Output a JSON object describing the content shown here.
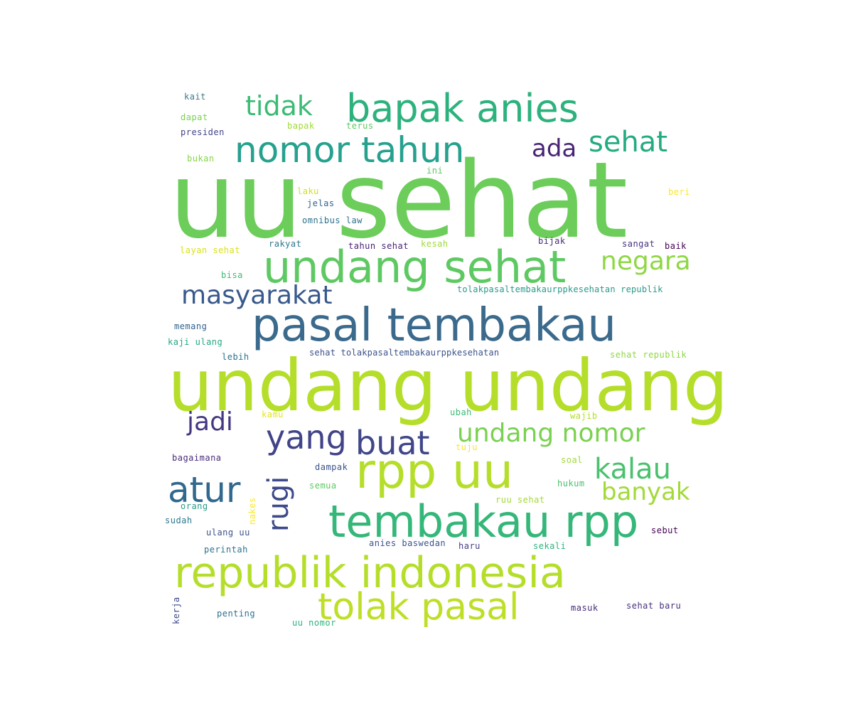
{
  "wordcloud": {
    "words": [
      {
        "text": "uu sehat",
        "color": "#6ccd5a"
      },
      {
        "text": "undang undang",
        "color": "#b5de2b"
      },
      {
        "text": "pasal tembakau",
        "color": "#3b6a8c"
      },
      {
        "text": "republik indonesia",
        "color": "#b5de2b"
      },
      {
        "text": "undang sehat",
        "color": "#5ec962"
      },
      {
        "text": "rpp uu",
        "color": "#b5de2b"
      },
      {
        "text": "tembakau rpp",
        "color": "#35b779"
      },
      {
        "text": "bapak anies",
        "color": "#2db27d"
      },
      {
        "text": "nomor tahun",
        "color": "#25a18e"
      },
      {
        "text": "tolak pasal",
        "color": "#bddf26"
      },
      {
        "text": "atur",
        "color": "#31688e"
      },
      {
        "text": "undang nomor",
        "color": "#7ad151"
      },
      {
        "text": "kalau",
        "color": "#4ac16d"
      },
      {
        "text": "buat",
        "color": "#404688"
      },
      {
        "text": "yang",
        "color": "#414487"
      },
      {
        "text": "masyarakat",
        "color": "#38598c"
      },
      {
        "text": "negara",
        "color": "#8fd744"
      },
      {
        "text": "banyak",
        "color": "#a2da37"
      },
      {
        "text": "tidak",
        "color": "#3cbb75"
      },
      {
        "text": "sehat",
        "color": "#25ab82"
      },
      {
        "text": "jadi",
        "color": "#453882"
      },
      {
        "text": "ada",
        "color": "#482475"
      },
      {
        "text": "rugi",
        "color": "#3e4a89"
      },
      {
        "text": "kait",
        "color": "#3b7c8a"
      },
      {
        "text": "dapat",
        "color": "#7ad151"
      },
      {
        "text": "presiden",
        "color": "#414487"
      },
      {
        "text": "bapak",
        "color": "#a2da37"
      },
      {
        "text": "terus",
        "color": "#5ec962"
      },
      {
        "text": "bukan",
        "color": "#86d549"
      },
      {
        "text": "ini",
        "color": "#5ec962"
      },
      {
        "text": "laku",
        "color": "#d0e11c"
      },
      {
        "text": "jelas",
        "color": "#33638d"
      },
      {
        "text": "beri",
        "color": "#fde725"
      },
      {
        "text": "omnibus law",
        "color": "#2d708e"
      },
      {
        "text": "layan sehat",
        "color": "#d8e219"
      },
      {
        "text": "rakyat",
        "color": "#2a788e"
      },
      {
        "text": "tahun sehat",
        "color": "#482475"
      },
      {
        "text": "kesah",
        "color": "#9fda3a"
      },
      {
        "text": "bijak",
        "color": "#472d7b"
      },
      {
        "text": "sangat",
        "color": "#46337f"
      },
      {
        "text": "baik",
        "color": "#440154"
      },
      {
        "text": "bisa",
        "color": "#3cbb75"
      },
      {
        "text": "tolakpasaltembakaurppkesehatan republik",
        "color": "#2a9a8b"
      },
      {
        "text": "memang",
        "color": "#33638d"
      },
      {
        "text": "kaji ulang",
        "color": "#22a884"
      },
      {
        "text": "lebih",
        "color": "#2c728e"
      },
      {
        "text": "sehat tolakpasaltembakaurppkesehatan",
        "color": "#3b528b"
      },
      {
        "text": "sehat republik",
        "color": "#8fd744"
      },
      {
        "text": "kamu",
        "color": "#e5e419"
      },
      {
        "text": "ubah",
        "color": "#3cbb75"
      },
      {
        "text": "wajib",
        "color": "#b5de2b"
      },
      {
        "text": "tuju",
        "color": "#fde725"
      },
      {
        "text": "bagaimana",
        "color": "#472c7a"
      },
      {
        "text": "dampak",
        "color": "#3b528b"
      },
      {
        "text": "soal",
        "color": "#9fda3a"
      },
      {
        "text": "semua",
        "color": "#5ec962"
      },
      {
        "text": "hukum",
        "color": "#4ac16d"
      },
      {
        "text": "orang",
        "color": "#2a9a8b"
      },
      {
        "text": "nakes",
        "color": "#fde725"
      },
      {
        "text": "ruu sehat",
        "color": "#a2da37"
      },
      {
        "text": "sudah",
        "color": "#2a788e"
      },
      {
        "text": "ulang uu",
        "color": "#3b528b"
      },
      {
        "text": "sebut",
        "color": "#440154"
      },
      {
        "text": "perintah",
        "color": "#2c728e"
      },
      {
        "text": "anies baswedan",
        "color": "#3b528b"
      },
      {
        "text": "haru",
        "color": "#433e85"
      },
      {
        "text": "sekali",
        "color": "#2db27d"
      },
      {
        "text": "kerja",
        "color": "#3e4989"
      },
      {
        "text": "penting",
        "color": "#2c728e"
      },
      {
        "text": "masuk",
        "color": "#472d7b"
      },
      {
        "text": "sehat baru",
        "color": "#46307e"
      },
      {
        "text": "uu nomor",
        "color": "#2db27d"
      }
    ]
  }
}
